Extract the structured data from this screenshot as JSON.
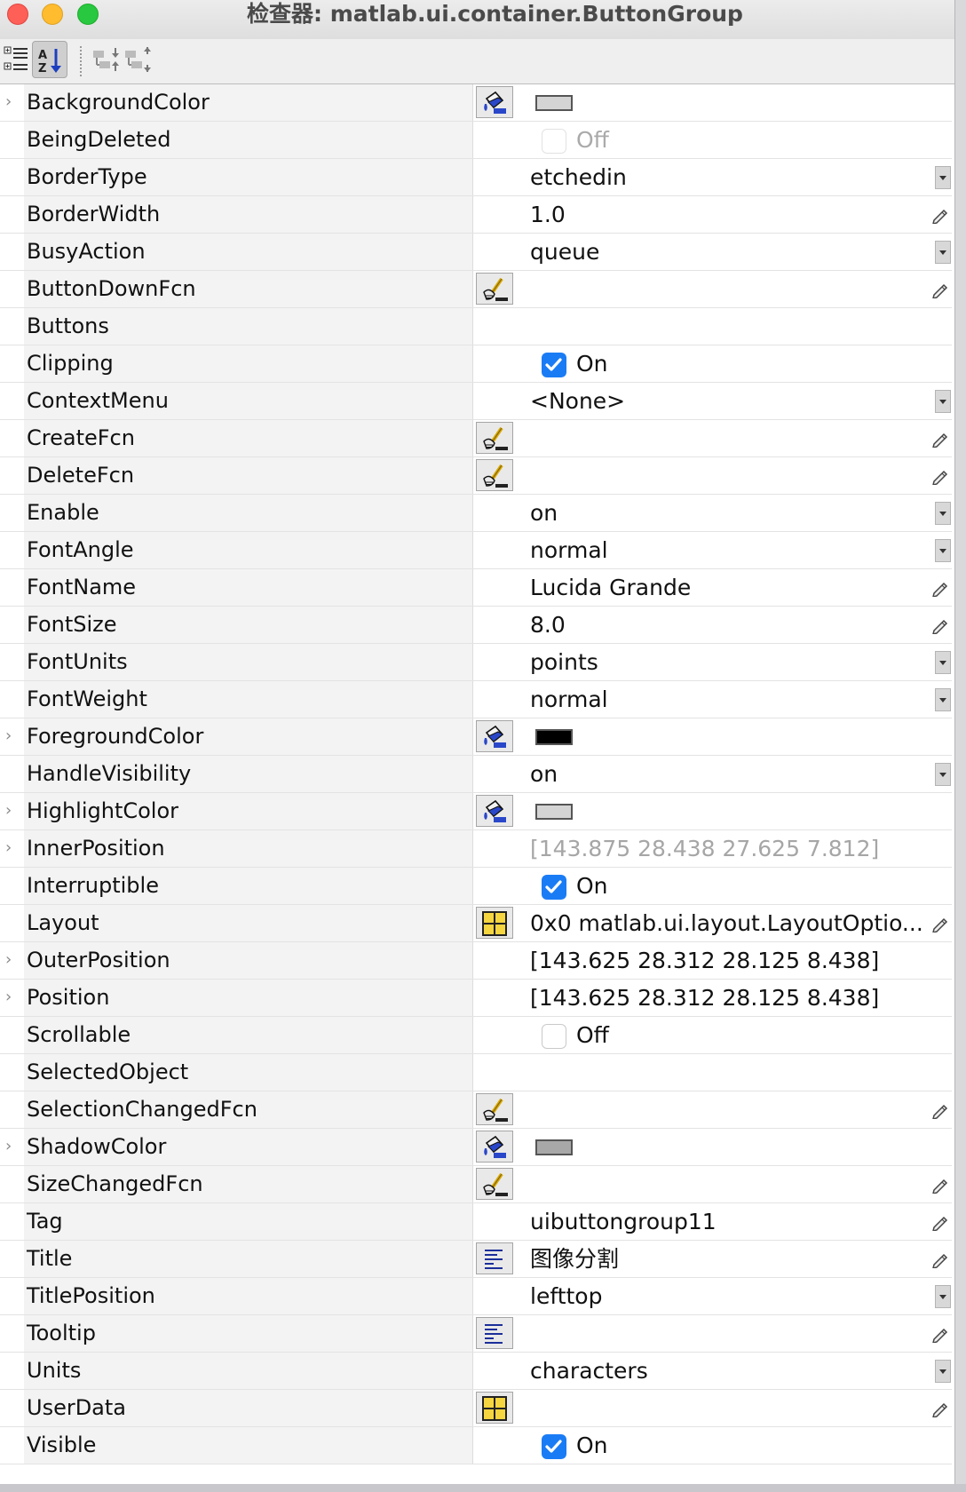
{
  "window": {
    "title": "检查器: matlab.ui.container.ButtonGroup"
  },
  "toolbar": {
    "buttons": [
      {
        "icon": "categorized-view-icon",
        "active": false
      },
      {
        "icon": "sort-alphabetical-icon",
        "active": true
      },
      {
        "icon": "expand-all-icon",
        "active": false
      },
      {
        "icon": "collapse-all-icon",
        "active": false
      }
    ]
  },
  "properties": [
    {
      "name": "BackgroundColor",
      "expandable": true,
      "kind": "color",
      "button": "color-picker-icon",
      "color": "#d4d4d4"
    },
    {
      "name": "BeingDeleted",
      "kind": "checkbox",
      "checked": false,
      "disabled": true,
      "value": "Off"
    },
    {
      "name": "BorderType",
      "kind": "dropdown",
      "value": "etchedin"
    },
    {
      "name": "BorderWidth",
      "kind": "edit",
      "value": "1.0"
    },
    {
      "name": "BusyAction",
      "kind": "dropdown",
      "value": "queue"
    },
    {
      "name": "ButtonDownFcn",
      "kind": "callback",
      "button": "callback-editor-icon",
      "value": ""
    },
    {
      "name": "Buttons",
      "kind": "text",
      "value": ""
    },
    {
      "name": "Clipping",
      "kind": "checkbox",
      "checked": true,
      "value": "On"
    },
    {
      "name": "ContextMenu",
      "kind": "dropdown",
      "value": "<None>"
    },
    {
      "name": "CreateFcn",
      "kind": "callback",
      "button": "callback-editor-icon",
      "value": ""
    },
    {
      "name": "DeleteFcn",
      "kind": "callback",
      "button": "callback-editor-icon",
      "value": ""
    },
    {
      "name": "Enable",
      "kind": "dropdown",
      "value": "on"
    },
    {
      "name": "FontAngle",
      "kind": "dropdown",
      "value": "normal"
    },
    {
      "name": "FontName",
      "kind": "edit",
      "value": "Lucida Grande"
    },
    {
      "name": "FontSize",
      "kind": "edit",
      "value": "8.0"
    },
    {
      "name": "FontUnits",
      "kind": "dropdown",
      "value": "points"
    },
    {
      "name": "FontWeight",
      "kind": "dropdown",
      "value": "normal"
    },
    {
      "name": "ForegroundColor",
      "expandable": true,
      "kind": "color",
      "button": "color-picker-icon",
      "color": "#000000"
    },
    {
      "name": "HandleVisibility",
      "kind": "dropdown",
      "value": "on"
    },
    {
      "name": "HighlightColor",
      "expandable": true,
      "kind": "color",
      "button": "color-picker-icon",
      "color": "#d4d4d4"
    },
    {
      "name": "InnerPosition",
      "expandable": true,
      "kind": "readonly",
      "value": "[143.875 28.438 27.625 7.812]"
    },
    {
      "name": "Interruptible",
      "kind": "checkbox",
      "checked": true,
      "value": "On"
    },
    {
      "name": "Layout",
      "kind": "edit",
      "button": "table-editor-icon",
      "value": "0x0 matlab.ui.layout.LayoutOptio..."
    },
    {
      "name": "OuterPosition",
      "expandable": true,
      "kind": "text",
      "value": "[143.625 28.312 28.125 8.438]"
    },
    {
      "name": "Position",
      "expandable": true,
      "kind": "text",
      "value": "[143.625 28.312 28.125 8.438]"
    },
    {
      "name": "Scrollable",
      "kind": "checkbox",
      "checked": false,
      "value": "Off"
    },
    {
      "name": "SelectedObject",
      "kind": "text",
      "value": ""
    },
    {
      "name": "SelectionChangedFcn",
      "kind": "callback",
      "button": "callback-editor-icon",
      "value": ""
    },
    {
      "name": "ShadowColor",
      "expandable": true,
      "kind": "color",
      "button": "color-picker-icon",
      "color": "#a8a8a8"
    },
    {
      "name": "SizeChangedFcn",
      "kind": "callback",
      "button": "callback-editor-icon",
      "value": ""
    },
    {
      "name": "Tag",
      "kind": "edit",
      "value": "uibuttongroup11"
    },
    {
      "name": "Title",
      "kind": "edit",
      "button": "text-editor-icon",
      "value": "图像分割"
    },
    {
      "name": "TitlePosition",
      "kind": "dropdown",
      "value": "lefttop"
    },
    {
      "name": "Tooltip",
      "kind": "edit",
      "button": "text-editor-icon",
      "value": ""
    },
    {
      "name": "Units",
      "kind": "dropdown",
      "value": "characters"
    },
    {
      "name": "UserData",
      "kind": "edit",
      "button": "table-editor-icon",
      "value": ""
    },
    {
      "name": "Visible",
      "kind": "checkbox",
      "checked": true,
      "value": "On"
    }
  ]
}
